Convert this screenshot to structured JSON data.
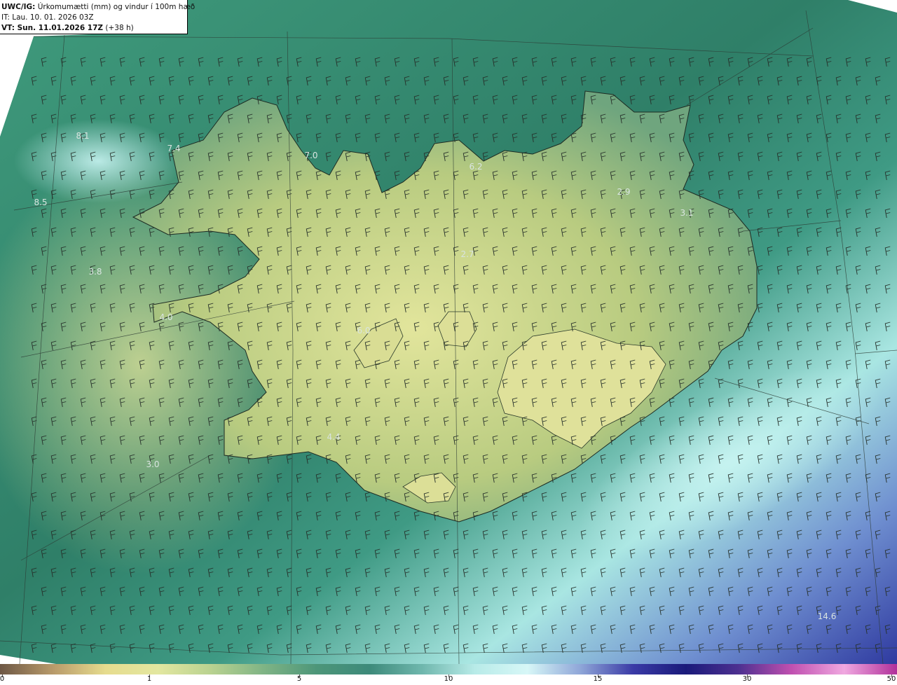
{
  "header": {
    "model": "UWC/IG:",
    "title": "Úrkomumætti (mm) og vindur í 100m hæð",
    "init_time": "IT: Lau. 10. 01. 2026 03Z",
    "valid_prefix": "VT: Sun. 11.01.2026 17Z",
    "lead": " (+38 h)"
  },
  "value_labels": [
    {
      "text": "8.1"
    },
    {
      "text": "7.4"
    },
    {
      "text": "7.0"
    },
    {
      "text": "6.2"
    },
    {
      "text": "2.9"
    },
    {
      "text": "3.1"
    },
    {
      "text": "8.5"
    },
    {
      "text": "3.8"
    },
    {
      "text": "2.7"
    },
    {
      "text": "4.0"
    },
    {
      "text": "6.0"
    },
    {
      "text": "4.4"
    },
    {
      "text": "3.0"
    },
    {
      "text": "14.6"
    }
  ],
  "colorbar": {
    "ticks": [
      "0",
      "1",
      "5",
      "10",
      "15",
      "30",
      "50"
    ],
    "colors": [
      "#6e5845",
      "#b89a6a",
      "#e6dc8e",
      "#e3e7a0",
      "#b9d290",
      "#7fb485",
      "#4d9679",
      "#3d8a7a",
      "#6fb7ad",
      "#b8ebe8",
      "#d7f7f7",
      "#8fa6d8",
      "#3a3aa6",
      "#1a1a7a",
      "#4d3090",
      "#c050b0",
      "#f0a8e0",
      "#b0309a"
    ]
  },
  "colors": {
    "sea": "#2f8a6e",
    "sea_light": "#a6e8e4",
    "land_low": "#b9c97a",
    "land_high": "#e0e39a",
    "deep": "#3a4fb0"
  }
}
